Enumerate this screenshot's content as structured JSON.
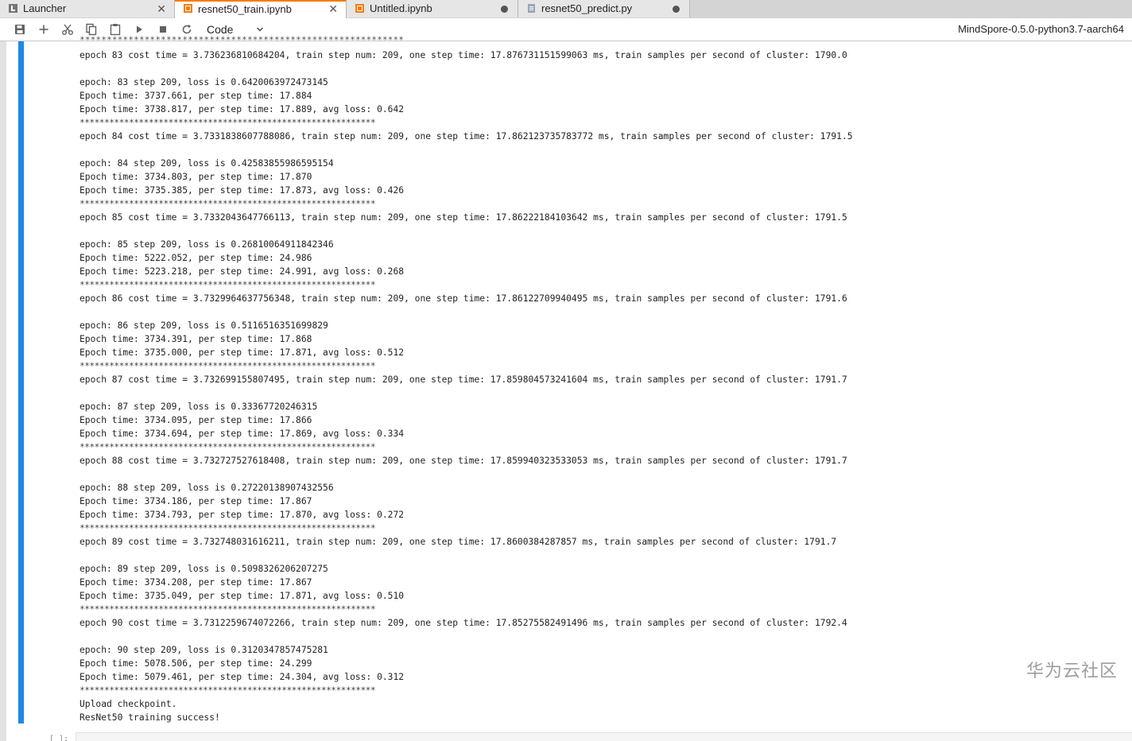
{
  "tabs": [
    {
      "label": "Launcher",
      "icon": "launcher-icon",
      "active": false,
      "state": "close"
    },
    {
      "label": "resnet50_train.ipynb",
      "icon": "notebook-icon",
      "active": true,
      "state": "close"
    },
    {
      "label": "Untitled.ipynb",
      "icon": "notebook-icon",
      "active": false,
      "state": "dirty"
    },
    {
      "label": "resnet50_predict.py",
      "icon": "file-icon",
      "active": false,
      "state": "dirty"
    }
  ],
  "toolbar": {
    "buttons": [
      "save-icon",
      "add-cell-icon",
      "cut-icon",
      "copy-icon",
      "paste-icon",
      "run-icon",
      "stop-icon",
      "restart-icon"
    ],
    "cell_type": "Code",
    "kernel": "MindSpore-0.5.0-python3.7-aarch64"
  },
  "output_lines": [
    "epoch 83 cost time = 3.736236810684204, train step num: 209, one step time: 17.876731151599063 ms, train samples per second of cluster: 1790.0",
    "",
    "epoch: 83 step 209, loss is 0.6420063972473145",
    "Epoch time: 3737.661, per step time: 17.884",
    "Epoch time: 3738.817, per step time: 17.889, avg loss: 0.642",
    "************************************************************",
    "epoch 84 cost time = 3.7331838607788086, train step num: 209, one step time: 17.862123735783772 ms, train samples per second of cluster: 1791.5",
    "",
    "epoch: 84 step 209, loss is 0.42583855986595154",
    "Epoch time: 3734.803, per step time: 17.870",
    "Epoch time: 3735.385, per step time: 17.873, avg loss: 0.426",
    "************************************************************",
    "epoch 85 cost time = 3.7332043647766113, train step num: 209, one step time: 17.86222184103642 ms, train samples per second of cluster: 1791.5",
    "",
    "epoch: 85 step 209, loss is 0.26810064911842346",
    "Epoch time: 5222.052, per step time: 24.986",
    "Epoch time: 5223.218, per step time: 24.991, avg loss: 0.268",
    "************************************************************",
    "epoch 86 cost time = 3.7329964637756348, train step num: 209, one step time: 17.86122709940495 ms, train samples per second of cluster: 1791.6",
    "",
    "epoch: 86 step 209, loss is 0.5116516351699829",
    "Epoch time: 3734.391, per step time: 17.868",
    "Epoch time: 3735.000, per step time: 17.871, avg loss: 0.512",
    "************************************************************",
    "epoch 87 cost time = 3.732699155807495, train step num: 209, one step time: 17.859804573241604 ms, train samples per second of cluster: 1791.7",
    "",
    "epoch: 87 step 209, loss is 0.33367720246315",
    "Epoch time: 3734.095, per step time: 17.866",
    "Epoch time: 3734.694, per step time: 17.869, avg loss: 0.334",
    "************************************************************",
    "epoch 88 cost time = 3.732727527618408, train step num: 209, one step time: 17.859940323533053 ms, train samples per second of cluster: 1791.7",
    "",
    "epoch: 88 step 209, loss is 0.27220138907432556",
    "Epoch time: 3734.186, per step time: 17.867",
    "Epoch time: 3734.793, per step time: 17.870, avg loss: 0.272",
    "************************************************************",
    "epoch 89 cost time = 3.732748031616211, train step num: 209, one step time: 17.8600384287857 ms, train samples per second of cluster: 1791.7",
    "",
    "epoch: 89 step 209, loss is 0.5098326206207275",
    "Epoch time: 3734.208, per step time: 17.867",
    "Epoch time: 3735.049, per step time: 17.871, avg loss: 0.510",
    "************************************************************",
    "epoch 90 cost time = 3.7312259674072266, train step num: 209, one step time: 17.85275582491496 ms, train samples per second of cluster: 1792.4",
    "",
    "epoch: 90 step 209, loss is 0.3120347857475281",
    "Epoch time: 5078.506, per step time: 24.299",
    "Epoch time: 5079.461, per step time: 24.304, avg loss: 0.312",
    "************************************************************",
    "Upload checkpoint.",
    "ResNet50 training success!"
  ],
  "next_cell_prompt": "[ ]:",
  "watermark": "华为云社区"
}
